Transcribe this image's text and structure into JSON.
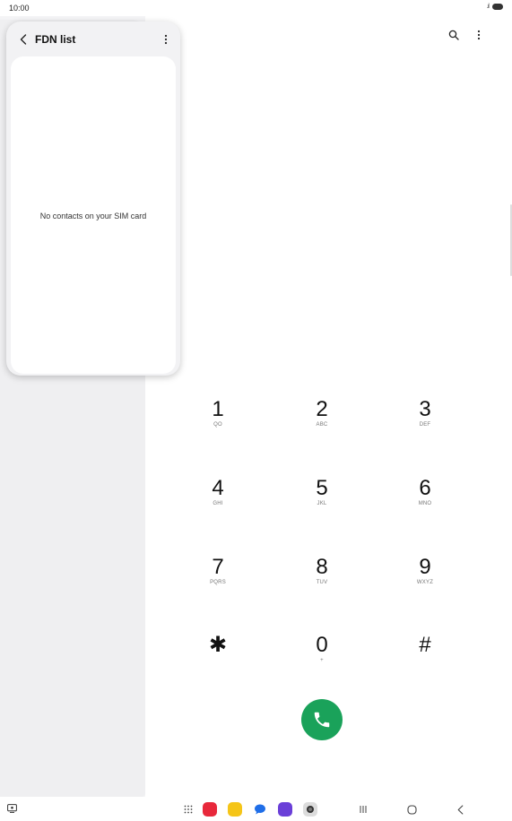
{
  "status_bar": {
    "time": "10:00",
    "signal_glyph": ".ıl"
  },
  "fdn": {
    "title": "FDN list",
    "empty_message": "No contacts on your SIM card"
  },
  "dialer": {
    "keys": [
      {
        "digit": "1",
        "letters": "QO"
      },
      {
        "digit": "2",
        "letters": "ABC"
      },
      {
        "digit": "3",
        "letters": "DEF"
      },
      {
        "digit": "4",
        "letters": "GHI"
      },
      {
        "digit": "5",
        "letters": "JKL"
      },
      {
        "digit": "6",
        "letters": "MNO"
      },
      {
        "digit": "7",
        "letters": "PQRS"
      },
      {
        "digit": "8",
        "letters": "TUV"
      },
      {
        "digit": "9",
        "letters": "WXYZ"
      },
      {
        "digit": "✱",
        "letters": ""
      },
      {
        "digit": "0",
        "letters": "+"
      },
      {
        "digit": "#",
        "letters": ""
      }
    ]
  },
  "colors": {
    "call_green": "#1aa25a",
    "app_red": "#e8283b",
    "app_yellow": "#f5c518",
    "app_blue": "#1f6ee8",
    "app_purple": "#6a3fd8",
    "app_gray": "#9a9a9a"
  },
  "icons": {
    "back": "chevron-left-icon",
    "more": "more-vertical-icon",
    "search": "search-icon",
    "call": "phone-icon",
    "nav_recents": "recents-icon",
    "nav_home": "home-icon",
    "nav_back": "back-icon",
    "apps": "app-grid-icon"
  }
}
